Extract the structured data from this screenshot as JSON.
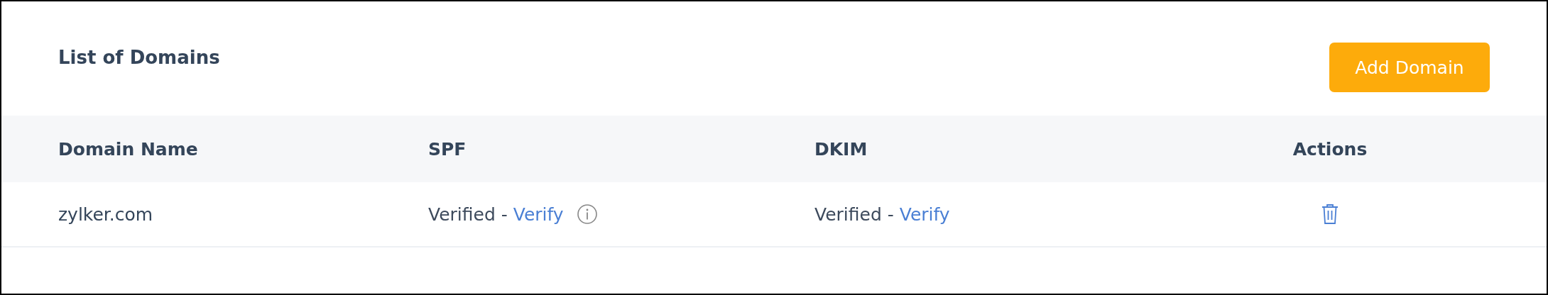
{
  "header": {
    "title": "List of Domains",
    "add_button": "Add Domain"
  },
  "table": {
    "columns": [
      "Domain Name",
      "SPF",
      "DKIM",
      "Actions"
    ],
    "rows": [
      {
        "domain": "zylker.com",
        "spf": {
          "status": "Verified -",
          "link": "Verify",
          "has_info": true
        },
        "dkim": {
          "status": "Verified -",
          "link": "Verify",
          "has_info": false
        }
      }
    ]
  }
}
